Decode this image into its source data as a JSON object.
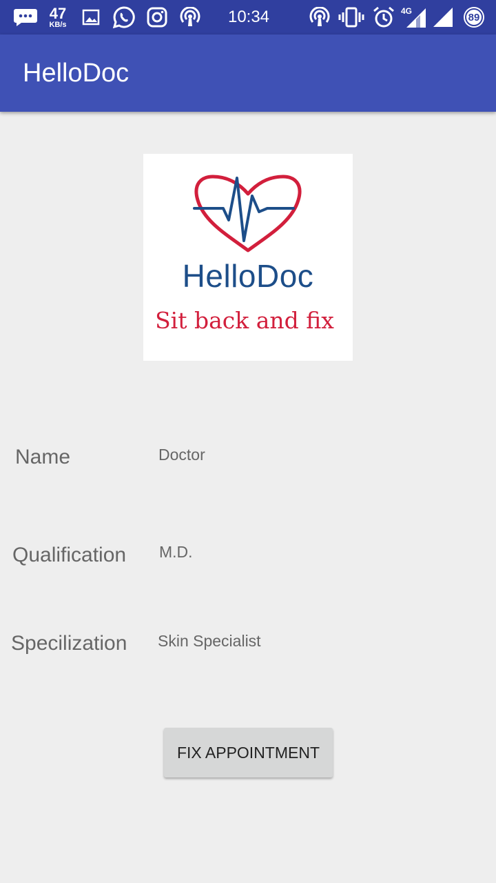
{
  "status_bar": {
    "speed_value": "47",
    "speed_unit": "KB/s",
    "time": "10:34",
    "network_type": "4G",
    "battery_level": "89"
  },
  "app_bar": {
    "title": "HelloDoc"
  },
  "logo": {
    "name": "HelloDoc",
    "tagline": "Sit back and fix"
  },
  "details": {
    "name_label": "Name",
    "name_value": "Doctor",
    "qualification_label": "Qualification",
    "qualification_value": "M.D.",
    "specialization_label": "Specilization",
    "specialization_value": "Skin Specialist"
  },
  "actions": {
    "fix_appointment_label": "FIX APPOINTMENT"
  },
  "colors": {
    "status_bar": "#303f9f",
    "app_bar": "#3f51b5",
    "background": "#eeeeee",
    "logo_blue": "#1d4e89",
    "logo_red": "#d21f3c"
  }
}
